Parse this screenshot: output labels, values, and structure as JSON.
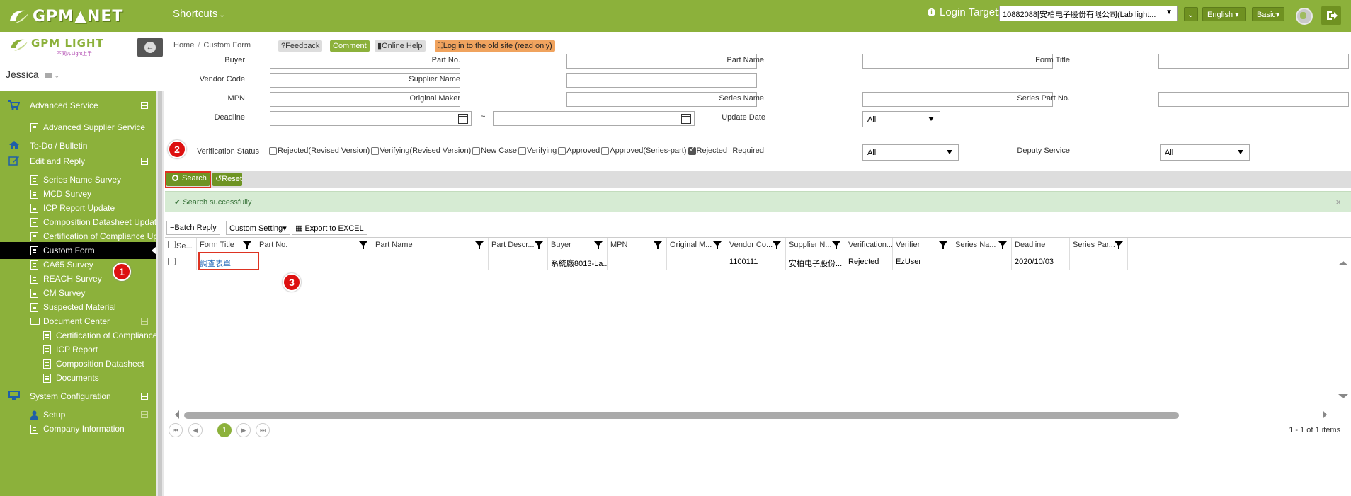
{
  "topbar": {
    "logo_text": "GPM▲NET",
    "shortcuts_label": "Shortcuts",
    "login_target_label": "Login Target:",
    "login_target_value": "10882088[安柏电子股份有限公司(Lab light...",
    "language": "English",
    "mode": "Basic"
  },
  "sidebar": {
    "logo_text": "GPM LIGHT",
    "logo_sub": "不同ルLight上手",
    "user": "Jessica",
    "items": [
      {
        "label": "Advanced Service"
      },
      {
        "label": "Advanced Supplier Service"
      },
      {
        "label": "To-Do / Bulletin"
      },
      {
        "label": "Edit and Reply"
      },
      {
        "label": "Series Name Survey"
      },
      {
        "label": "MCD Survey"
      },
      {
        "label": "ICP Report Update"
      },
      {
        "label": "Composition Datasheet Update"
      },
      {
        "label": "Certification of Compliance Update"
      },
      {
        "label": "Custom Form"
      },
      {
        "label": "CA65 Survey"
      },
      {
        "label": "REACH Survey"
      },
      {
        "label": "CM Survey"
      },
      {
        "label": "Suspected Material"
      },
      {
        "label": "Document Center"
      },
      {
        "label": "Certification of Compliance"
      },
      {
        "label": "ICP Report"
      },
      {
        "label": "Composition Datasheet"
      },
      {
        "label": "Documents"
      },
      {
        "label": "System Configuration"
      },
      {
        "label": "Setup"
      },
      {
        "label": "Company Information"
      }
    ]
  },
  "breadcrumb": {
    "home": "Home",
    "sep": "/",
    "current": "Custom Form"
  },
  "tags": {
    "feedback": "Feedback",
    "comment": "Comment",
    "help": "Online Help",
    "old_site": "Log in to the old site (read only)"
  },
  "form": {
    "buyer": "Buyer",
    "part_no": "Part No.",
    "part_name": "Part Name",
    "form_title": "Form Title",
    "vendor_code": "Vendor Code",
    "supplier_name": "Supplier Name",
    "mpn": "MPN",
    "original_maker": "Original Maker",
    "series_name": "Series Name",
    "series_part_no": "Series Part No.",
    "deadline": "Deadline",
    "tilde": "~",
    "update_date": "Update Date",
    "update_date_value": "All",
    "verification_status": "Verification Status",
    "required": "Required",
    "required_value": "All",
    "deputy_service": "Deputy Service",
    "deputy_service_value": "All",
    "statuses": [
      {
        "label": "Rejected(Revised Version)",
        "checked": false
      },
      {
        "label": "Verifying(Revised Version)",
        "checked": false
      },
      {
        "label": "New Case",
        "checked": false
      },
      {
        "label": "Verifying",
        "checked": false
      },
      {
        "label": "Approved",
        "checked": false
      },
      {
        "label": "Approved(Series-part)",
        "checked": false
      },
      {
        "label": "Rejected",
        "checked": true
      }
    ]
  },
  "actions": {
    "search": "Search",
    "reset": "Reset"
  },
  "alert": {
    "text": "✔ Search successfully",
    "close": "×"
  },
  "grid_toolbar": {
    "batch_reply": "Batch Reply",
    "custom_setting": "Custom Setting",
    "export": "Export to EXCEL"
  },
  "grid": {
    "columns": [
      "Se...",
      "Form Title",
      "Part No.",
      "Part Name",
      "Part Descr...",
      "Buyer",
      "MPN",
      "Original M...",
      "Vendor Co...",
      "Supplier N...",
      "Verification...",
      "Verifier",
      "Series Na...",
      "Deadline",
      "Series Par..."
    ],
    "rows": [
      [
        "",
        "調查表單",
        "",
        "",
        "",
        "系統廠8013-La...",
        "",
        "",
        "1100111",
        "安柏电子股份...",
        "Rejected",
        "EzUser",
        "",
        "2020/10/03",
        ""
      ]
    ]
  },
  "pager": {
    "page": "1",
    "info": "1 - 1 of 1 items"
  },
  "badges": [
    "1",
    "2",
    "3"
  ],
  "colors": {
    "brand": "#8cb13b",
    "highlight": "#dd2222"
  }
}
